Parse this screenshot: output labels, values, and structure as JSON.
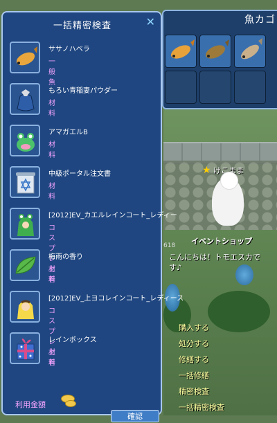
{
  "window": {
    "title": "一括精密検査",
    "close_icon": "close-icon"
  },
  "items": [
    {
      "name": "ササノハベラ",
      "type": "一般魚",
      "icon": "fish-icon"
    },
    {
      "name": "もろい青稲妻パウダー",
      "type": "材料",
      "icon": "powder-bag-icon"
    },
    {
      "name": "アマガエルB",
      "type": "材料",
      "icon": "frog-icon"
    },
    {
      "name": "中級ポータル注文書",
      "type": "材料",
      "icon": "scroll-icon"
    },
    {
      "name": "[2012]EV_カエルレインコート_レディー",
      "type": "コスプレ上着",
      "icon": "frog-raincoat-icon"
    },
    {
      "name": "梅雨の香り",
      "type": "材料",
      "icon": "leaf-icon"
    },
    {
      "name": "[2012]EV_上ヨコレインコート_レディース",
      "type": "コスプレ上着",
      "icon": "chick-raincoat-icon"
    },
    {
      "name": "レインボックス",
      "type": "材料",
      "icon": "gift-box-icon"
    }
  ],
  "footer": {
    "fee_label": "利用金額",
    "confirm_label": "確認",
    "coin_icon": "gold-coin-icon"
  },
  "basket": {
    "title": "魚カゴ",
    "slots_filled": 3
  },
  "npc": {
    "name": "けこまま",
    "shop_title": "イベントショップ",
    "shop_id": "618",
    "greeting": "こんにちは！トモエスカです♪",
    "menu": [
      "購入する",
      "処分する",
      "修繕する",
      "一括修繕",
      "精密検査",
      "一括精密検査"
    ]
  },
  "colors": {
    "window_bg": "#1f4680",
    "item_type": "#f4a4ff",
    "menu_text": "#ffffa0"
  }
}
